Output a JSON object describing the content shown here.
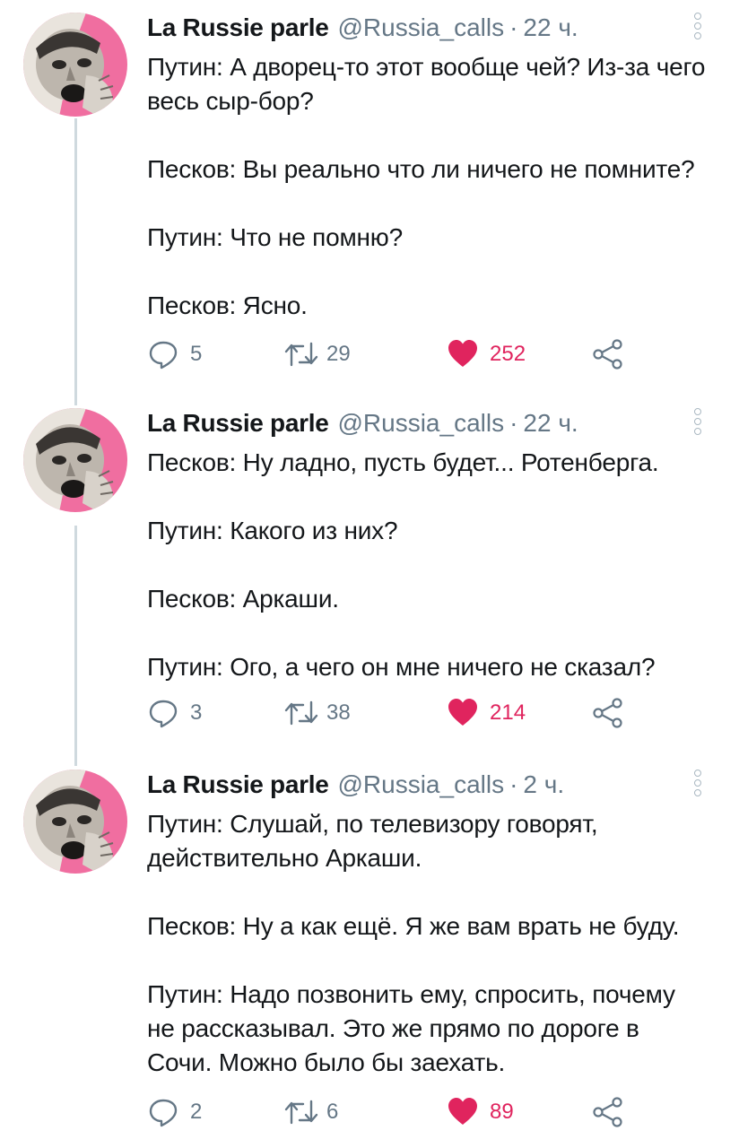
{
  "tweets": [
    {
      "author": {
        "name": "La Russie parle",
        "handle": "@Russia_calls"
      },
      "time": "22 ч.",
      "lines": [
        "Путин: А дворец-то этот вообще чей? Из-за чего\nвесь сыр-бор?",
        "Песков: Вы реально что ли ничего не помните?",
        "Путин: Что не помню?",
        "Песков: Ясно."
      ],
      "replies": "5",
      "retweets": "29",
      "likes": "252"
    },
    {
      "author": {
        "name": "La Russie parle",
        "handle": "@Russia_calls"
      },
      "time": "22 ч.",
      "lines": [
        "Песков: Ну ладно, пусть будет... Ротенберга.",
        "Путин: Какого из них?",
        "Песков: Аркаши.",
        "Путин: Ого, а чего он мне ничего не сказал?"
      ],
      "replies": "3",
      "retweets": "38",
      "likes": "214"
    },
    {
      "author": {
        "name": "La Russie parle",
        "handle": "@Russia_calls"
      },
      "time": "2 ч.",
      "lines": [
        "Путин: Слушай, по телевизору говорят,\nдействительно Аркаши.",
        "Песков: Ну а как ещё. Я же вам врать не буду.",
        "Путин: Надо позвонить ему, спросить, почему\nне рассказывал. Это же прямо по дороге в\nСочи. Можно было бы заехать."
      ],
      "replies": "2",
      "retweets": "6",
      "likes": "89"
    }
  ],
  "colors": {
    "like": "#e0245e",
    "muted": "#657786",
    "thread": "#cfd9de",
    "avatar_bg": "#f06ea0"
  },
  "icons": [
    "reply-icon",
    "retweet-icon",
    "heart-icon",
    "share-icon",
    "more-options-icon"
  ]
}
